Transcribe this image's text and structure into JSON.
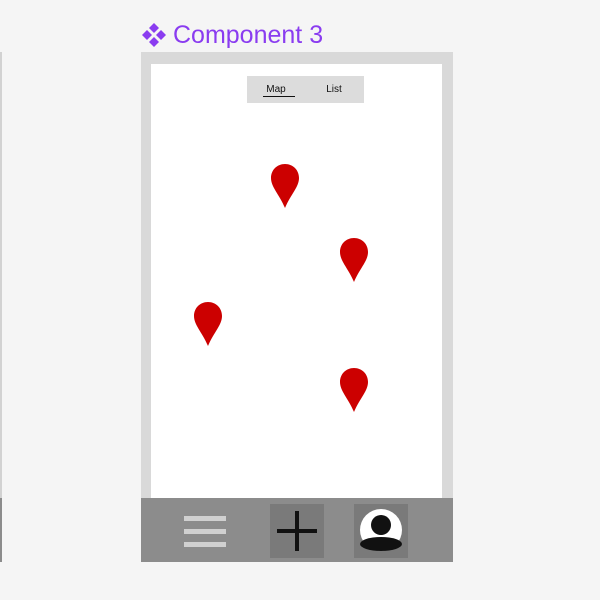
{
  "component": {
    "title": "Component 3",
    "icon": "component-icon",
    "accent_color": "#8a3cf0"
  },
  "tabs": [
    {
      "label": "Map",
      "selected": true
    },
    {
      "label": "List",
      "selected": false
    }
  ],
  "map": {
    "pin_icon": "location-pin-icon",
    "pin_color": "#cc0000",
    "pin_count": 4
  },
  "bottom_bar": {
    "buttons": [
      {
        "name": "menu-button",
        "icon": "hamburger-menu-icon"
      },
      {
        "name": "add-button",
        "icon": "plus-icon"
      },
      {
        "name": "profile-button",
        "icon": "user-avatar-icon"
      }
    ]
  }
}
